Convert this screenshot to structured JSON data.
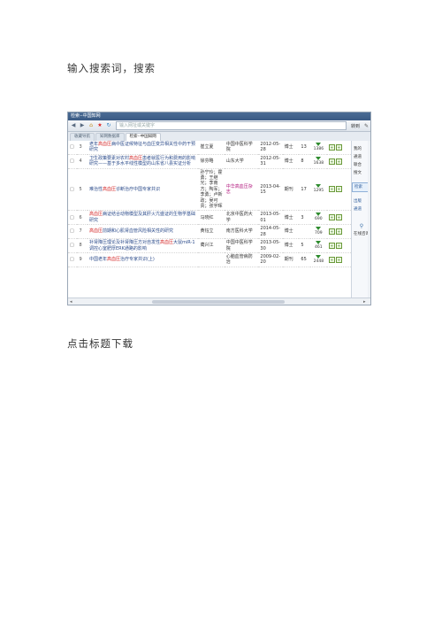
{
  "captions": {
    "search": "输入搜索词，搜索",
    "download": "点击标题下载"
  },
  "browser": {
    "window_title": "检索--中国知网",
    "address_placeholder": "输入网址或关键字",
    "right_label": "转到",
    "tabs": [
      {
        "label": "收藏导航"
      },
      {
        "label": "知网数据库"
      },
      {
        "label": "检索--中国知网",
        "active": true
      }
    ]
  },
  "results": [
    {
      "n": "3",
      "pre": "老年",
      "hl": "高血压",
      "post": "病中医证候特征与血压变异相关性中药干预研究",
      "author": "崔立夏",
      "source": "中国中医科学院",
      "date": "2012-05-28",
      "type": "博士",
      "cite": "13",
      "downloads": "1386"
    },
    {
      "n": "4",
      "pre": "卫生政策要素对农村",
      "hl": "高血压",
      "post": "患者就医行为和费用的影响研究——基于多水平线性模型的山东省八县实证分析",
      "author": "徐芬略",
      "source": "山东大学",
      "date": "2012-05-31",
      "type": "博士",
      "cite": "8",
      "downloads": "1638"
    },
    {
      "n": "5",
      "pre": "难治性",
      "hl": "高血压",
      "post": "诊断治疗中国专家共识",
      "author": "孙宁玲；霍勇；王继光；李南方；陶军；李勇；卢新政；吴可贵；张宇晖",
      "source": "中华高血压杂志",
      "date": "2013-04-15",
      "type": "期刊",
      "cite": "17",
      "downloads": "1295",
      "magenta": true
    },
    {
      "n": "6",
      "pre": "",
      "hl": "高血压",
      "post": "病证结合动物模型及其肝火亢盛证的生物学基础研究",
      "author": "马晓红",
      "source": "北京中医药大学",
      "date": "2013-05-01",
      "type": "博士",
      "cite": "3",
      "downloads": "690"
    },
    {
      "n": "7",
      "pre": "",
      "hl": "高血压",
      "post": "前期和心肌肾血管风险相关性的研究",
      "author": "黄钰立",
      "source": "南方医科大学",
      "date": "2014-05-28",
      "type": "博士",
      "cite": "",
      "downloads": "709"
    },
    {
      "n": "8",
      "pre": "补肾降压理论及补肾降压方对自发性",
      "hl": "高血压",
      "post": "大鼠miR-1调控心室肥厚ERK通路的影响",
      "author": "蔺兴江",
      "source": "中国中医科学院",
      "date": "2013-05-30",
      "type": "博士",
      "cite": "5",
      "downloads": "461"
    },
    {
      "n": "9",
      "pre": "中国老年",
      "hl": "高血压",
      "post": "治疗专家共识(上)",
      "author": "",
      "source": "心脑血管病防治",
      "date": "2009-02-20",
      "type": "期刊",
      "cite": "65",
      "downloads": "2448"
    }
  ],
  "sidebar": {
    "items": [
      "我的",
      "通道",
      "联合",
      "搜文"
    ],
    "selected": "检索",
    "items2": [
      "出版",
      "通道"
    ],
    "pin_label": "在线咨询"
  }
}
